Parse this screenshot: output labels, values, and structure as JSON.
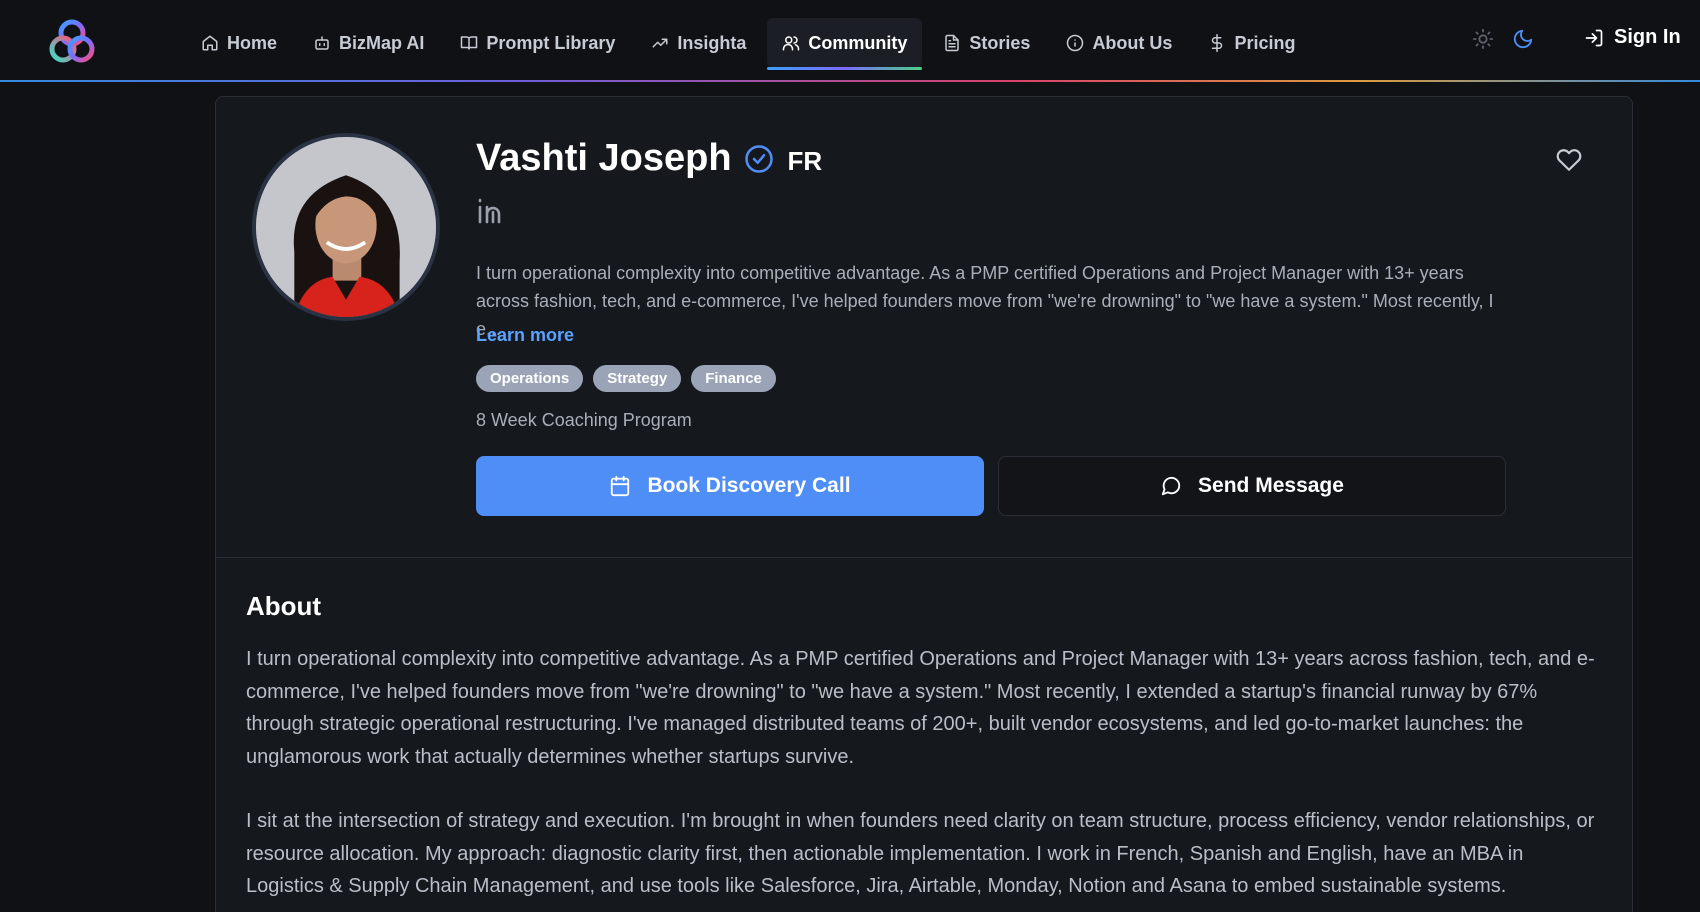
{
  "nav": {
    "items": [
      {
        "label": "Home",
        "icon": "home-icon",
        "active": false
      },
      {
        "label": "BizMap AI",
        "icon": "bot-icon",
        "active": false
      },
      {
        "label": "Prompt Library",
        "icon": "book-icon",
        "active": false
      },
      {
        "label": "Insighta",
        "icon": "trending-up-icon",
        "active": false
      },
      {
        "label": "Community",
        "icon": "users-icon",
        "active": true
      },
      {
        "label": "Stories",
        "icon": "file-text-icon",
        "active": false
      },
      {
        "label": "About Us",
        "icon": "info-icon",
        "active": false
      },
      {
        "label": "Pricing",
        "icon": "dollar-icon",
        "active": false
      }
    ],
    "sign_in": "Sign In"
  },
  "profile": {
    "name": "Vashti Joseph",
    "language": "FR",
    "bio_short": "I turn operational complexity into competitive advantage. As a PMP certified Operations and Project Manager with 13+ years across fashion, tech, and e-commerce, I've helped founders move from \"we're drowning\" to \"we have a system.\" Most recently, I e...",
    "learn_more": "Learn more",
    "tags": [
      "Operations",
      "Strategy",
      "Finance"
    ],
    "program": "8 Week Coaching Program",
    "book_call": "Book Discovery Call",
    "send_message": "Send Message"
  },
  "about": {
    "title": "About",
    "paragraphs": [
      "I turn operational complexity into competitive advantage. As a PMP certified Operations and Project Manager with 13+ years across fashion, tech, and e-commerce, I've helped founders move from \"we're drowning\" to \"we have a system.\" Most recently, I extended a startup's financial runway by 67% through strategic operational restructuring. I've managed distributed teams of 200+, built vendor ecosystems, and led go-to-market launches: the unglamorous work that actually determines whether startups survive.",
      "I sit at the intersection of strategy and execution. I'm brought in when founders need clarity on team structure, process efficiency, vendor relationships, or resource allocation. My approach: diagnostic clarity first, then actionable implementation. I work in French, Spanish and English, have an MBA in Logistics & Supply Chain Management, and use tools like Salesforce, Jira, Airtable, Monday, Notion and Asana to embed sustainable systems."
    ]
  },
  "colors": {
    "background": "#0f1115",
    "card": "#15181d",
    "accent": "#4f8ef7",
    "link": "#5aa2ff",
    "tag": "#9aa4b6"
  }
}
